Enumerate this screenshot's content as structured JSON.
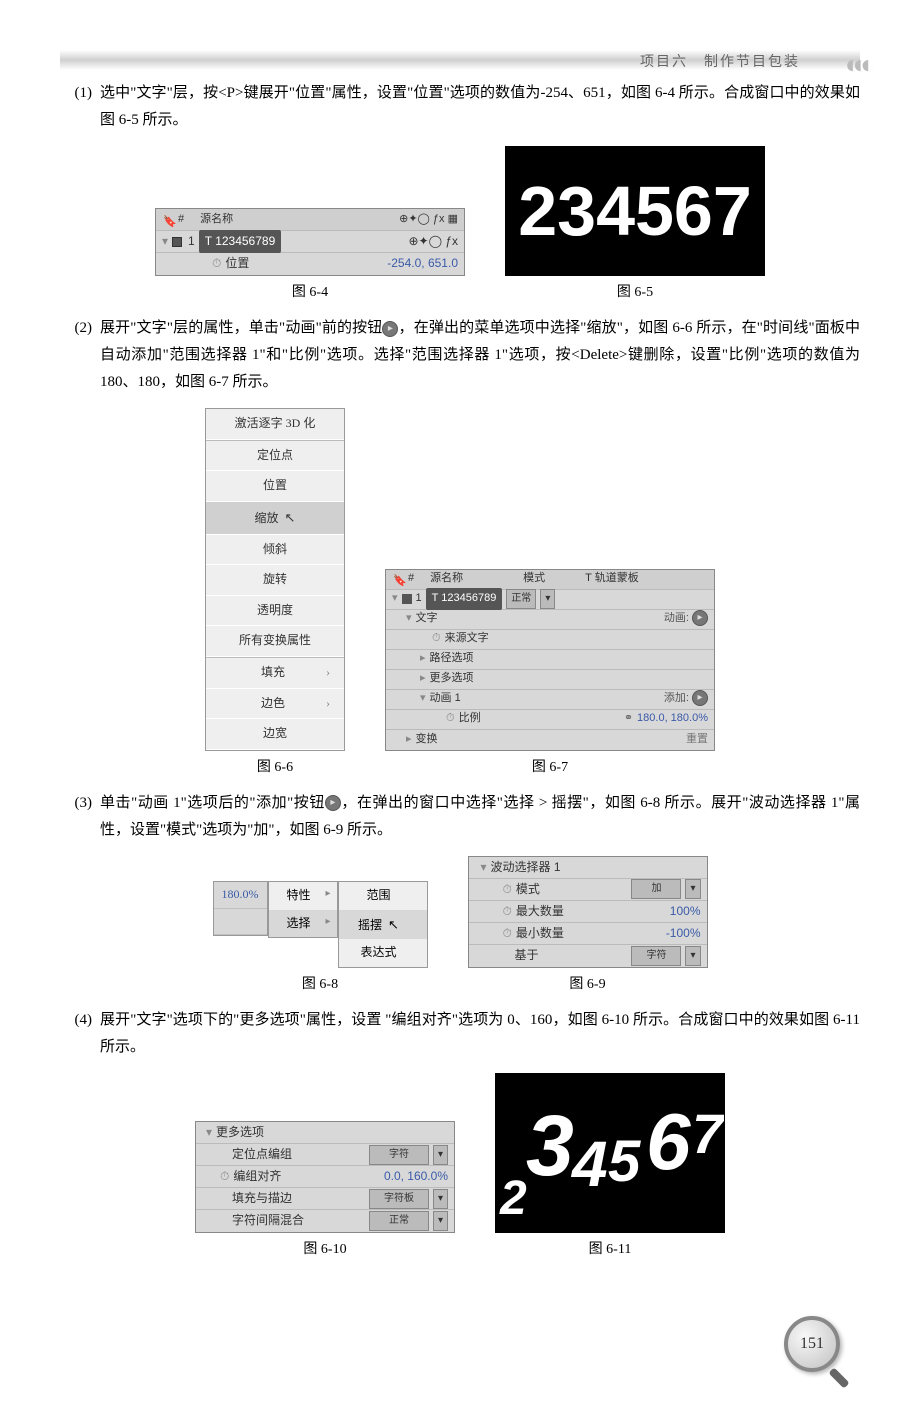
{
  "header": {
    "title": "项目六　制作节目包装"
  },
  "step1": {
    "num": "(1)",
    "text": "选中\"文字\"层，按<P>键展开\"位置\"属性，设置\"位置\"选项的数值为-254、651，如图 6-4 所示。合成窗口中的效果如图 6-5 所示。"
  },
  "fig64": {
    "caption": "图 6-4",
    "col_num": "#",
    "col_name": "源名称",
    "layer_num": "1",
    "layer_type": "T",
    "layer_name": "123456789",
    "prop_position": "位置",
    "pos_value": "-254.0, 651.0"
  },
  "fig65": {
    "caption": "图 6-5",
    "text": "234567"
  },
  "step2": {
    "num": "(2)",
    "text": "展开\"文字\"层的属性，单击\"动画\"前的按钮 ，在弹出的菜单选项中选择\"缩放\"，如图 6-6 所示，在\"时间线\"面板中自动添加\"范围选择器 1\"和\"比例\"选项。选择\"范围选择器 1\"选项，按<Delete>键删除，设置\"比例\"选项的数值为180、180，如图 6-7 所示。"
  },
  "fig66": {
    "caption": "图 6-6",
    "items": [
      "激活逐字 3D 化",
      "定位点",
      "位置",
      "缩放",
      "倾斜",
      "旋转",
      "透明度",
      "所有变换属性",
      "填充",
      "边色",
      "边宽"
    ],
    "selected": "缩放"
  },
  "fig67": {
    "caption": "图 6-7",
    "col_num": "#",
    "col_name": "源名称",
    "col_mode": "模式",
    "col_trk": "T 轨道蒙板",
    "layer_num": "1",
    "layer_type": "T",
    "layer_name": "123456789",
    "mode_val": "正常",
    "text_group": "文字",
    "animate_btn": "动画:",
    "src_text": "来源文字",
    "path_opts": "路径选项",
    "more_opts": "更多选项",
    "anim1": "动画 1",
    "add_btn": "添加:",
    "scale_label": "比例",
    "scale_value": "180.0, 180.0%",
    "transform": "变换",
    "reset": "重置"
  },
  "step3": {
    "num": "(3)",
    "text": "单击\"动画 1\"选项后的\"添加\"按钮 ，在弹出的窗口中选择\"选择 > 摇摆\"，如图 6-8 所示。展开\"波动选择器 1\"属性，设置\"模式\"选项为\"加\"，如图 6-9 所示。"
  },
  "fig68": {
    "caption": "图 6-8",
    "val": "180.0%",
    "menu1": [
      "特性",
      "选择"
    ],
    "menu1_sel": "选择",
    "menu2": [
      "范围",
      "摇摆",
      "表达式"
    ],
    "menu2_sel": "摇摆"
  },
  "fig69": {
    "caption": "图 6-9",
    "group": "波动选择器 1",
    "mode_label": "模式",
    "mode_val": "加",
    "max_label": "最大数量",
    "max_val": "100%",
    "min_label": "最小数量",
    "min_val": "-100%",
    "based_label": "基于",
    "based_val": "字符"
  },
  "step4": {
    "num": "(4)",
    "text": "展开\"文字\"选项下的\"更多选项\"属性，设置 \"编组对齐\"选项为 0、160，如图 6-10 所示。合成窗口中的效果如图 6-11 所示。"
  },
  "fig610": {
    "caption": "图 6-10",
    "group": "更多选项",
    "anchor_group": "定位点编组",
    "anchor_val": "字符",
    "align_label": "编组对齐",
    "align_val": "0.0, 160.0%",
    "fillstroke_label": "填充与描边",
    "fillstroke_val": "字符板",
    "blend_label": "字符间隔混合",
    "blend_val": "正常"
  },
  "fig611": {
    "caption": "图 6-11",
    "digits": [
      "2",
      "3",
      "4",
      "5",
      "6",
      "7"
    ]
  },
  "page_number": "151"
}
